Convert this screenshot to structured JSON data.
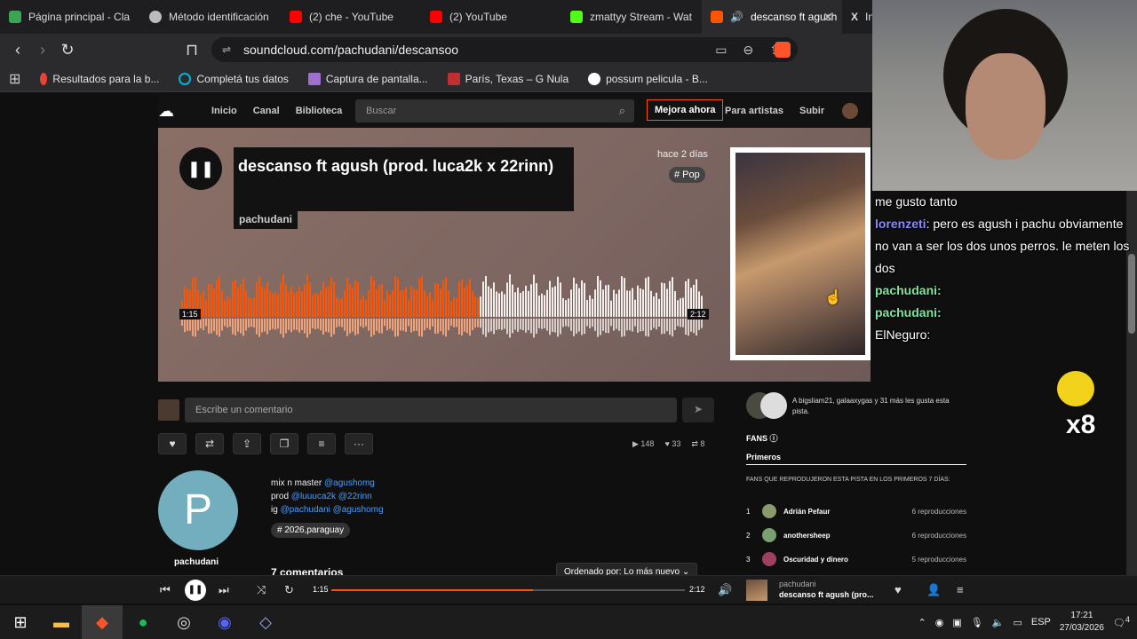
{
  "tabs": [
    {
      "label": "Página principal - Cla",
      "color": "#3aa655"
    },
    {
      "label": "Método identificación",
      "color": "#bbbbbb"
    },
    {
      "label": "(2) che - YouTube",
      "color": "#ff0000"
    },
    {
      "label": "(2) YouTube",
      "color": "#ff0000"
    },
    {
      "label": "zmattyy Stream - Wat",
      "color": "#53fc18"
    },
    {
      "label": "descanso ft agush",
      "color": "#ff5500",
      "active": true
    },
    {
      "label": "Inic",
      "color": "#ffffff"
    }
  ],
  "address": {
    "url": "soundcloud.com/pachudani/descansoo"
  },
  "bookmarks": [
    "Resultados para la b...",
    "Completá tus datos",
    "Captura de pantalla...",
    "París, Texas – G Nula",
    "possum pelicula - B..."
  ],
  "sc_nav": {
    "home": "Inicio",
    "channel": "Canal",
    "library": "Biblioteca",
    "search_placeholder": "Buscar",
    "upgrade": "Mejora ahora",
    "artists": "Para artistas",
    "upload": "Subir"
  },
  "track": {
    "title": "descanso ft agush (prod. luca2k x 22rinn)",
    "artist": "pachudani",
    "posted": "hace 2 días",
    "genre": "# Pop",
    "time_current": "1:15",
    "time_total": "2:12",
    "progress": 0.57
  },
  "comment": {
    "placeholder": "Escribe un comentario"
  },
  "stats": {
    "plays": "148",
    "likes": "33",
    "reposts": "8"
  },
  "profile": {
    "initial": "P",
    "name": "pachudani"
  },
  "description": {
    "line1_pre": "mix n master ",
    "line1_link": "@agushomg",
    "line2_pre": "prod ",
    "line2_link1": "@luuuca2k",
    "line2_link2": "@22rinn",
    "line3_pre": "ig ",
    "line3_link1": "@pachudani",
    "line3_link2": "@agushomg",
    "tag": "# 2026,paraguay"
  },
  "comments_title": "7 comentarios",
  "sort_label": "Ordenado por: Lo más nuevo",
  "likers_text": "A bigsliam21, galaaxygas y 31 más les gusta esta pista.",
  "fans": {
    "header": "FANS",
    "tab": "Primeros",
    "sub": "FANS QUE REPRODUJERON ESTA PISTA EN LOS PRIMEROS 7 DÍAS:",
    "rows": [
      {
        "rank": "1",
        "name": "Adrián Pefaur",
        "plays": "6 reproducciones",
        "color": "#8a9a6a"
      },
      {
        "rank": "2",
        "name": "anothersheep",
        "plays": "6 reproducciones",
        "color": "#7aa070"
      },
      {
        "rank": "3",
        "name": "Oscuridad y dinero",
        "plays": "5 reproducciones",
        "color": "#a04060"
      }
    ]
  },
  "player": {
    "time_current": "1:15",
    "time_total": "2:12",
    "artist": "pachudani",
    "title": "descanso ft agush (pro...",
    "progress": 0.57
  },
  "tray": {
    "lang": "ESP",
    "time": "17:21",
    "date": "27/03/2026",
    "notif": "4"
  },
  "chat": {
    "l0": "me gusto tanto",
    "u1": "lorenzeti",
    "m1": "pero es agush i pachu obviamente no van a ser los dos unos perros. le meten los dos",
    "u2": "pachudani:",
    "u3": "pachudani:",
    "u4": "ElNeguro:"
  },
  "emote_count": "x8"
}
